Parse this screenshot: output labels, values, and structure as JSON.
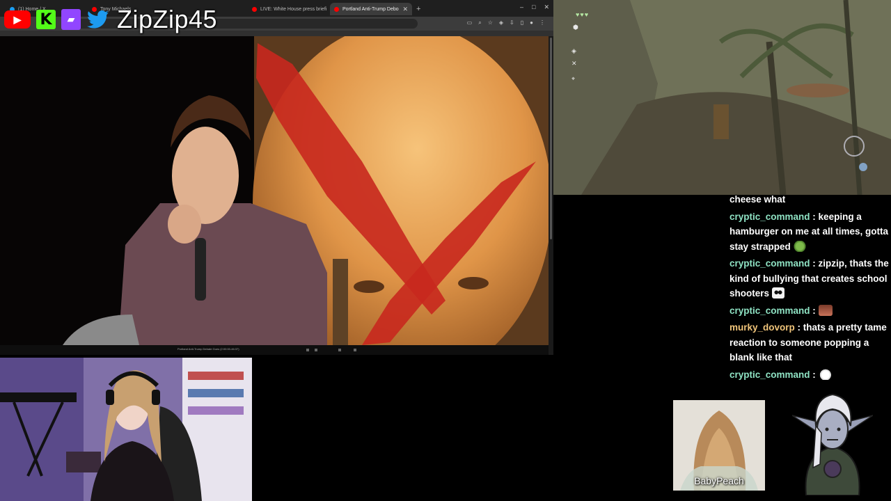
{
  "browser": {
    "tabs": [
      {
        "label": "(1) Home / X",
        "color": "#1d9bf0",
        "active": false
      },
      {
        "label": "Tony Michaels",
        "color": "#ff0000",
        "active": false
      },
      {
        "label": "LIVE: White House press briefi",
        "color": "#ff0000",
        "active": false
      },
      {
        "label": "Portland Anti-Trump Debo",
        "color": "#ff0000",
        "active": true
      }
    ],
    "new_tab": "+",
    "window_controls": {
      "minimize": "–",
      "maximize": "□",
      "close": "✕"
    },
    "address_text": "",
    "video_title": "Portland Anti-Trump Debate Goes (2:00:00-46:37)"
  },
  "overlay": {
    "username": "ZipZip45",
    "icons": {
      "youtube": "youtube-icon",
      "kick": "kick-icon",
      "twitch": "twitch-icon",
      "twitter": "twitter-icon"
    },
    "kick_letter": "K"
  },
  "chat": {
    "messages": [
      {
        "user": "",
        "text": "cheese what",
        "emote": ""
      },
      {
        "user": "cryptic_command",
        "text": "keeping a hamburger on me at all times, gotta stay strapped",
        "emote": "frog"
      },
      {
        "user": "cryptic_command",
        "text": "zipzip, thats the kind of bullying that creates school shooters",
        "emote": "panda"
      },
      {
        "user": "cryptic_command",
        "text": "",
        "emote": "face"
      },
      {
        "user": "murky_dovorp",
        "text": "thats a pretty tame reaction to someone popping a blank like that",
        "emote": ""
      },
      {
        "user": "cryptic_command",
        "text": "",
        "emote": "hand"
      }
    ],
    "separator": " : "
  },
  "guests": {
    "babypeach_label": "BabyPeach"
  },
  "colors": {
    "chat_user": "#8fe3c4",
    "chat_user_alt": "#f0c47a",
    "youtube": "#ff0000",
    "kick": "#53fc18",
    "twitch": "#9146ff",
    "twitter": "#1d9bf0"
  }
}
